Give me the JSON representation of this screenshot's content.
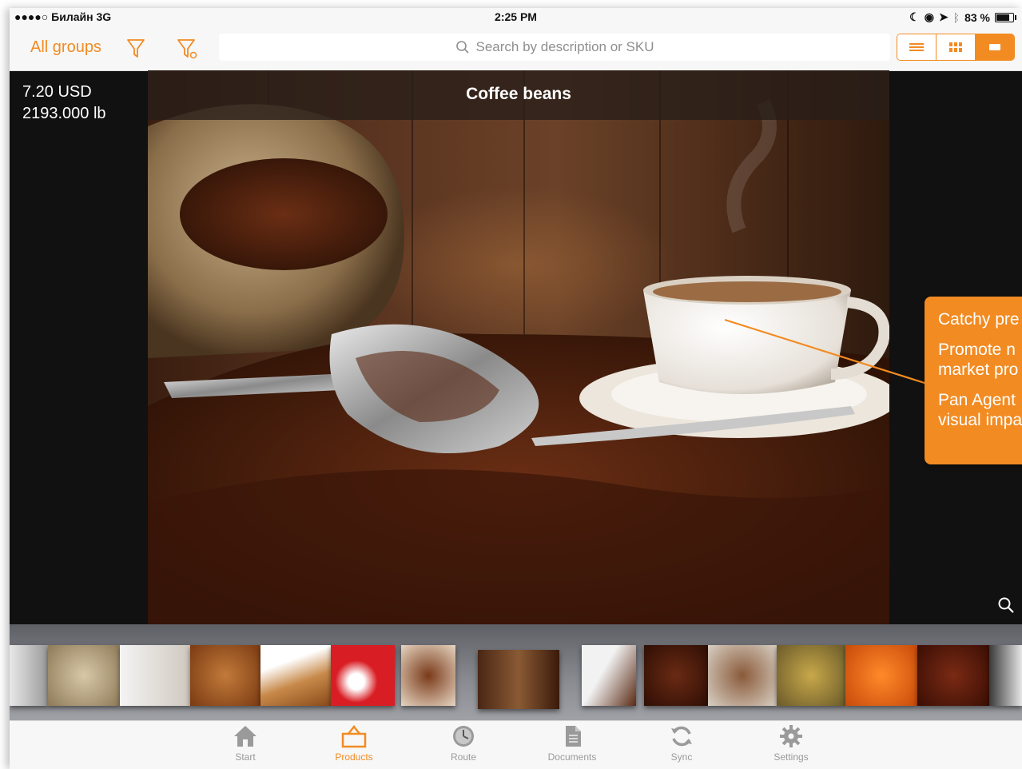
{
  "status": {
    "carrier": "●●●●○ Билайн  3G",
    "time": "2:25 PM",
    "battery": "83 %"
  },
  "toolbar": {
    "group_label": "All groups",
    "search_placeholder": "Search by description or SKU",
    "view_modes": [
      "list",
      "grid",
      "single"
    ],
    "active_view": "single"
  },
  "product": {
    "price": "7.20 USD",
    "stock": "2193.000 lb",
    "title": "Coffee beans"
  },
  "callout": {
    "line1": "Catchy pre",
    "line2a": "Promote n",
    "line2b": "market pro",
    "line3a": "Pan Agent",
    "line3b": "visual impa"
  },
  "carousel": {
    "thumbnails": [
      "coffee-grinder",
      "cashews",
      "vanilla-bags",
      "cinnamon",
      "cinnamon-sticks",
      "salt",
      "cocoa-beans",
      "coffee-beans",
      "coffee-mug",
      "coffee-pile",
      "dates",
      "dried-fruit",
      "dried-apricots",
      "coffee-dark",
      "sugar"
    ]
  },
  "tabs": [
    {
      "label": "Start",
      "icon": "home-icon"
    },
    {
      "label": "Products",
      "icon": "products-icon"
    },
    {
      "label": "Route",
      "icon": "clock-icon"
    },
    {
      "label": "Documents",
      "icon": "document-icon"
    },
    {
      "label": "Sync",
      "icon": "sync-icon"
    },
    {
      "label": "Settings",
      "icon": "gear-icon"
    }
  ],
  "colors": {
    "accent": "#f28b22",
    "background": "#111111",
    "bar": "#f7f7f7"
  }
}
